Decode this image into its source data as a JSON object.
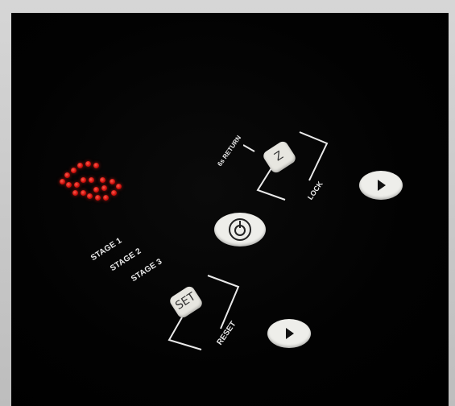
{
  "stages": [
    "STAGE 1",
    "STAGE 2",
    "STAGE 3"
  ],
  "lock_label": "LOCK",
  "return_label": "6s RETURN",
  "reset_label": "RESET",
  "set_label": "SET",
  "lock_glyph": "Z",
  "colors": {
    "panel": "#000000",
    "led": "#e0140f",
    "button": "#eeeeea",
    "label": "#e9e9e9"
  },
  "display_icons": [
    "led-dot-matrix"
  ],
  "icons": [
    "power-icon",
    "play-arrow-icon",
    "play-arrow-icon"
  ]
}
